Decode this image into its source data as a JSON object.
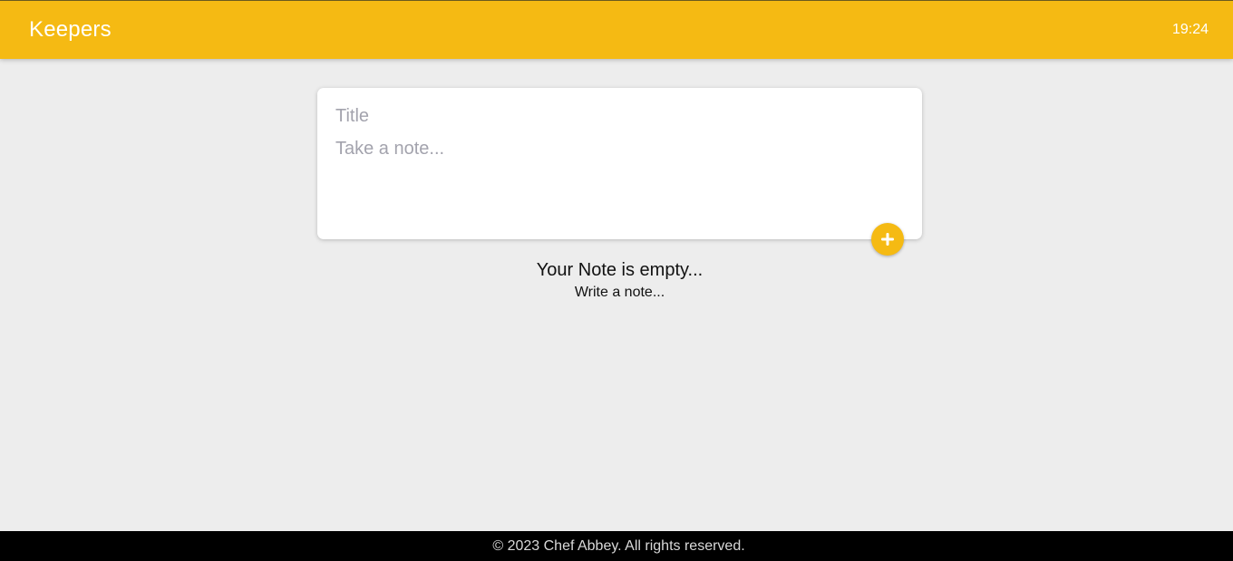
{
  "header": {
    "title": "Keepers",
    "time": "19:24",
    "background_color": "#f5ba13"
  },
  "note_form": {
    "title_placeholder": "Title",
    "title_value": "",
    "content_placeholder": "Take a note...",
    "content_value": "",
    "add_button_icon": "plus-icon",
    "accent_color": "#f5ba13"
  },
  "empty_state": {
    "title": "Your Note is empty...",
    "subtitle": "Write a note..."
  },
  "footer": {
    "text": "© 2023 Chef Abbey. All rights reserved."
  }
}
